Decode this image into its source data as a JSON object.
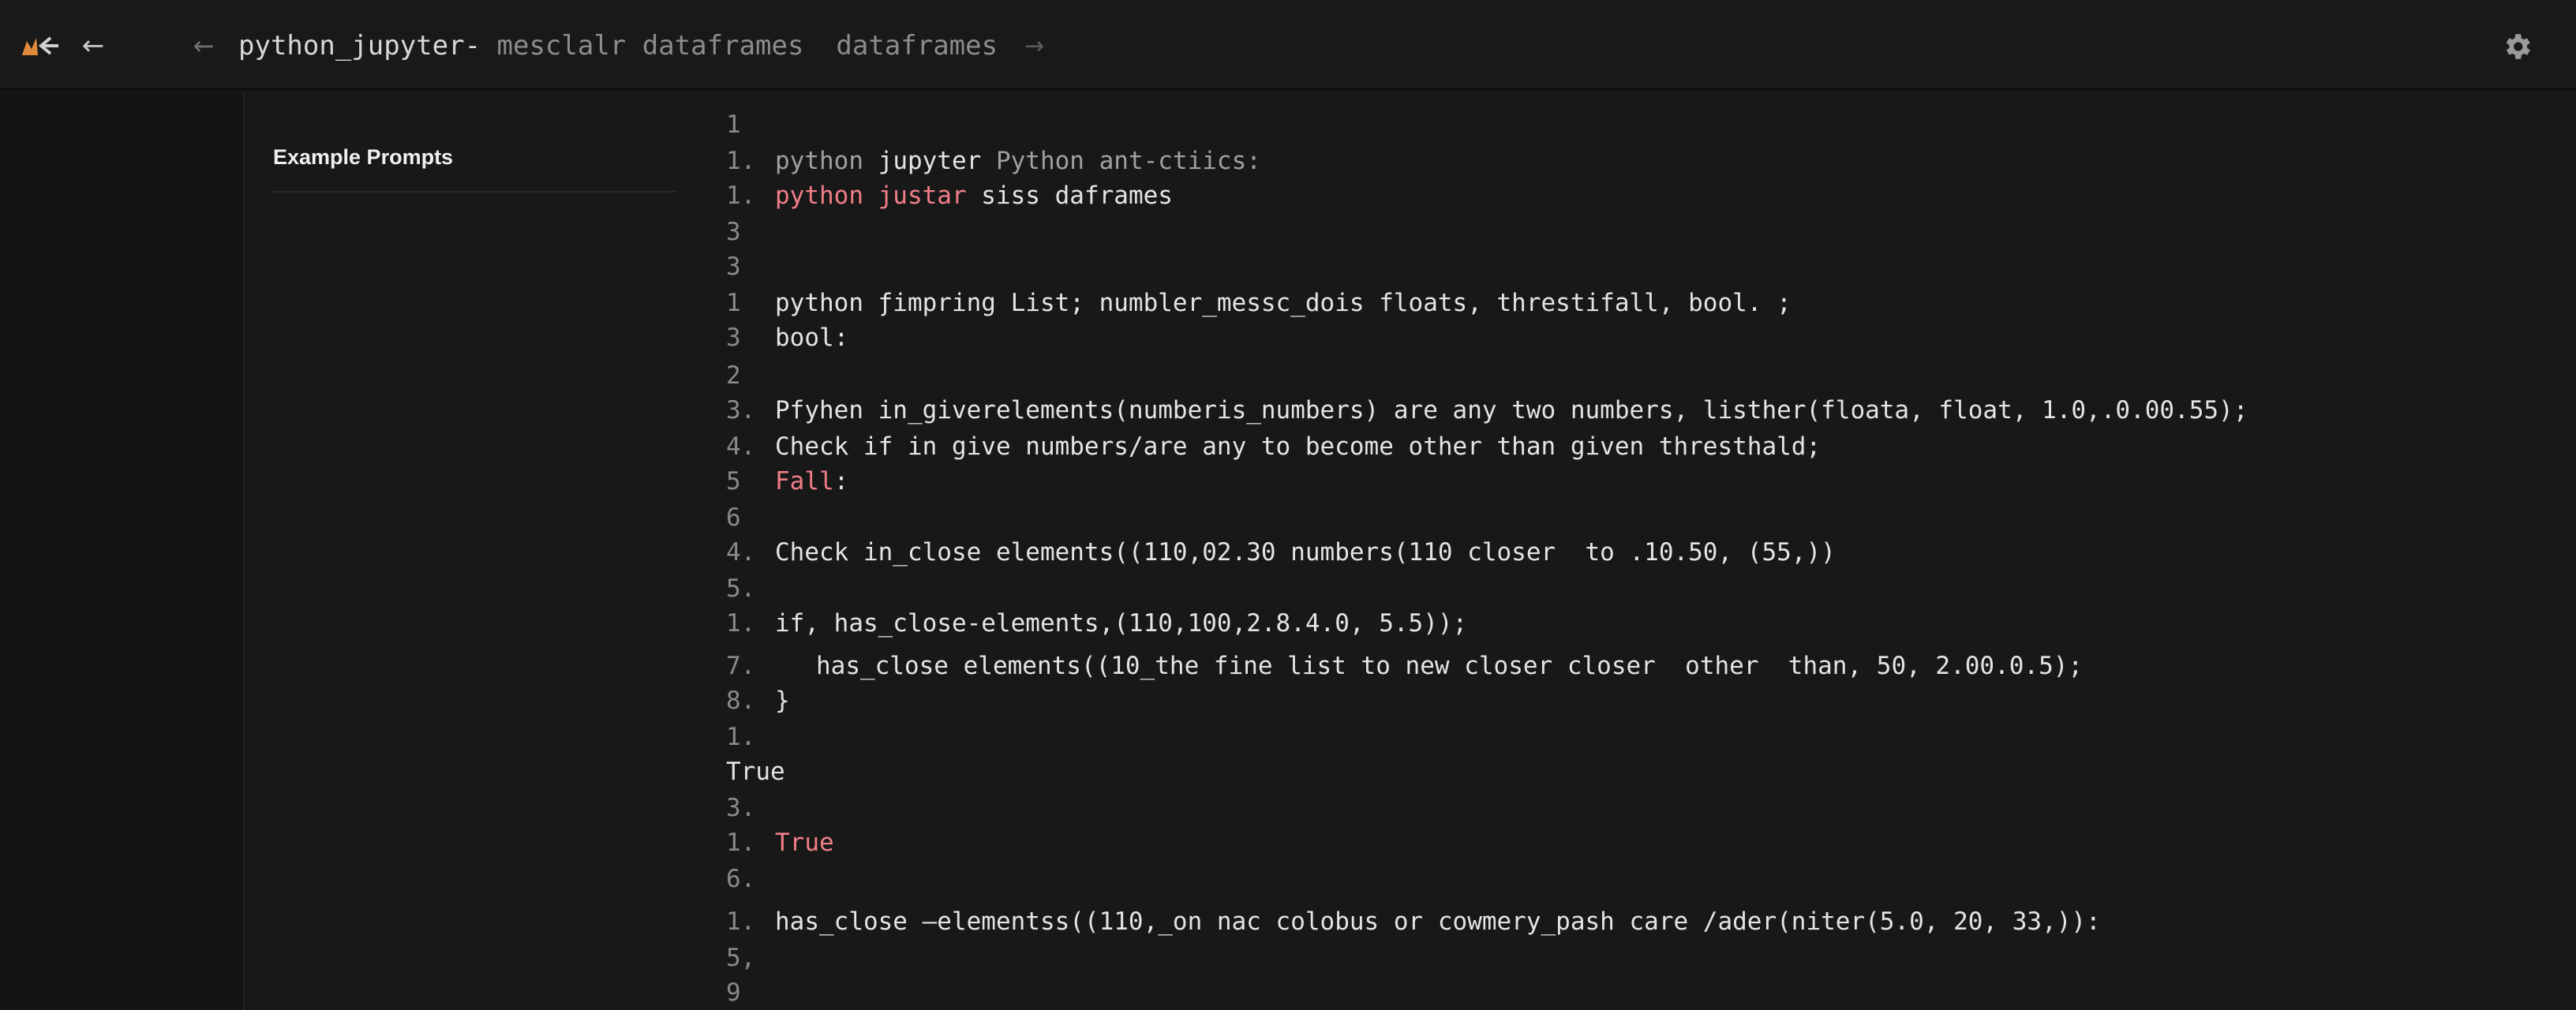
{
  "header": {
    "breadcrumb_main": "python_jupyter-",
    "breadcrumb_sub": " mesclalr dataframes  dataframes"
  },
  "sidebar": {
    "title": "Example Prompts"
  },
  "editor": {
    "lines": [
      {
        "num": "1",
        "parts": []
      },
      {
        "num": "1.",
        "parts": [
          {
            "t": "python ",
            "c": "muted"
          },
          {
            "t": "jupyter",
            "c": ""
          },
          {
            "t": " Python ant-ctiics:",
            "c": "muted"
          }
        ]
      },
      {
        "num": "1.",
        "parts": [
          {
            "t": "python justar",
            "c": "red"
          },
          {
            "t": " siss daframes",
            "c": ""
          }
        ]
      },
      {
        "num": "3",
        "parts": []
      },
      {
        "num": "3",
        "parts": []
      },
      {
        "num": "1",
        "parts": [
          {
            "t": "python ƒimpring List; numbler_messc_dois floats, threstifall, bool. ;",
            "c": ""
          }
        ]
      },
      {
        "num": "3",
        "parts": [
          {
            "t": "bool:",
            "c": ""
          }
        ]
      },
      {
        "num": "2",
        "parts": []
      },
      {
        "num": "3.",
        "parts": [
          {
            "t": "Pfyhen in_giverelements(numberis_numbers) are any two numbers, listher(floata, float, 1.0,.0.00.55);",
            "c": ""
          }
        ]
      },
      {
        "num": "4.",
        "parts": [
          {
            "t": "Check if in give numbers/are any to become other than given thresthald;",
            "c": ""
          }
        ]
      },
      {
        "num": "5",
        "parts": [
          {
            "t": "Fall",
            "c": "red"
          },
          {
            "t": ":",
            "c": ""
          }
        ]
      },
      {
        "num": "6",
        "parts": []
      },
      {
        "num": "4.",
        "parts": [
          {
            "t": "Check in_close elements((110,02.30 numbers(110 closer  to .10.50, (55,))",
            "c": ""
          }
        ]
      },
      {
        "num": "5.",
        "parts": []
      },
      {
        "num": "1.",
        "parts": [
          {
            "t": "if, has_close-elements,(110,100,2.8.4.0, 5.5));",
            "c": ""
          }
        ]
      },
      {
        "num": "7.",
        "parts": [
          {
            "t": "has_close elements((10_the fine list to new closer closer  other  than, 50, 2.00.0.5);",
            "c": ""
          }
        ]
      },
      {
        "num": "8.",
        "parts": [
          {
            "t": "}",
            "c": ""
          }
        ]
      },
      {
        "num": "1.",
        "parts": []
      },
      {
        "num": "",
        "parts": [
          {
            "t": "True",
            "c": ""
          }
        ]
      },
      {
        "num": "3.",
        "parts": []
      },
      {
        "num": "1.",
        "parts": [
          {
            "t": "True",
            "c": "red"
          }
        ]
      },
      {
        "num": "6.",
        "parts": []
      },
      {
        "num": "1.",
        "parts": [
          {
            "t": "has_close –elementss((110,_on nac colobus or cowmery_pash care /ader(niter(5.0, 20, 33,)):",
            "c": ""
          }
        ]
      },
      {
        "num": "5,",
        "parts": []
      },
      {
        "num": "9",
        "parts": []
      }
    ]
  },
  "colors": {
    "background": "#161616",
    "accent_red": "#f07e88",
    "logo_orange": "#e08a3c"
  },
  "icons": {
    "app_logo": "app-logo-icon",
    "back": "arrow-left-icon",
    "crumb_back": "arrow-left-icon",
    "crumb_forward": "arrow-right-icon",
    "settings": "gear-icon"
  }
}
